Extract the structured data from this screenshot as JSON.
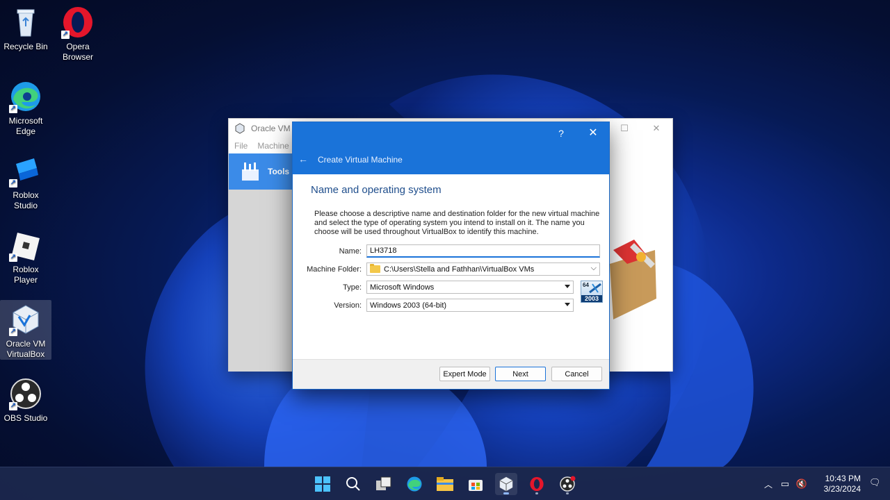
{
  "desktop": {
    "icons": [
      {
        "label": "Recycle Bin"
      },
      {
        "label": "Opera Browser"
      },
      {
        "label": "Microsoft Edge"
      },
      {
        "label": "Roblox Studio"
      },
      {
        "label": "Roblox Player"
      },
      {
        "label": "Oracle VM VirtualBox"
      },
      {
        "label": "OBS Studio"
      }
    ]
  },
  "manager": {
    "title": "Oracle VM V",
    "menu": [
      "File",
      "Machine"
    ],
    "tools_label": "Tools"
  },
  "dialog": {
    "caption": "Create Virtual Machine",
    "help_glyph": "?",
    "heading": "Name and operating system",
    "description": "Please choose a descriptive name and destination folder for the new virtual machine and select the type of operating system you intend to install on it. The name you choose will be used throughout VirtualBox to identify this machine.",
    "fields": {
      "name_label": "Name:",
      "name_value": "LH3718",
      "folder_label": "Machine Folder:",
      "folder_value": "C:\\Users\\Stella and Fathhan\\VirtualBox VMs",
      "type_label": "Type:",
      "type_value": "Microsoft Windows",
      "version_label": "Version:",
      "version_value": "Windows 2003 (64-bit)"
    },
    "os_badge": {
      "top": "64",
      "bottom": "2003"
    },
    "buttons": {
      "expert": "Expert Mode",
      "next": "Next",
      "cancel": "Cancel"
    }
  },
  "taskbar": {
    "time": "10:43 PM",
    "date": "3/23/2024",
    "accent": "#1a73d9"
  }
}
